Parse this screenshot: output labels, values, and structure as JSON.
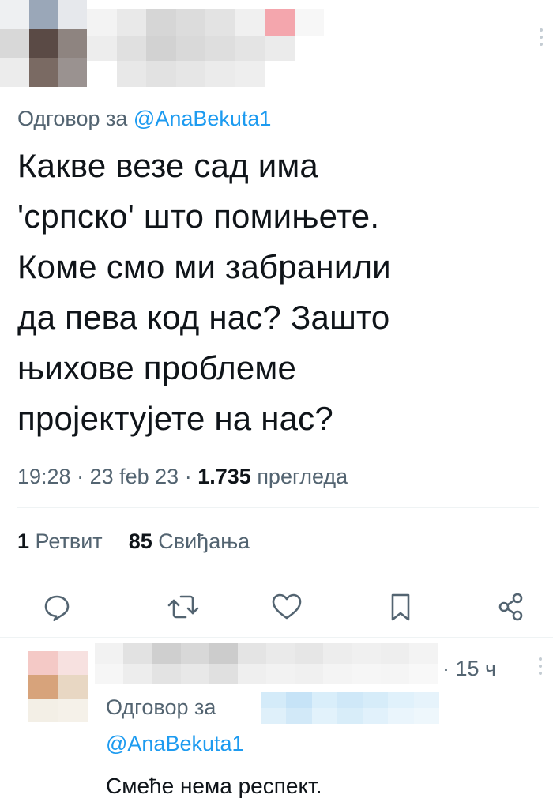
{
  "tweet": {
    "reply_prefix": "Одговор за",
    "reply_handle": "@AnaBekuta1",
    "text_lines": [
      "Какве везе сад има",
      "'српско' што помињете.",
      "Коме смо ми забранили",
      "да пева код нас? Зашто",
      "њихове проблеме",
      "пројектујете на нас?"
    ],
    "time": "19:28",
    "date": "23 feb 23",
    "views_count": "1.735",
    "views_label": "прегледа",
    "retweets_count": "1",
    "retweets_label": "Ретвит",
    "likes_count": "85",
    "likes_label": "Свиђања"
  },
  "reply": {
    "time_ago": "15 ч",
    "reply_prefix": "Одговор за",
    "reply_handle": "@AnaBekuta1",
    "text": "Смеће нема респект."
  },
  "actions": {
    "reply_icon": "reply-icon",
    "retweet_icon": "retweet-icon",
    "like_icon": "heart-icon",
    "bookmark_icon": "bookmark-icon",
    "share_icon": "share-icon"
  }
}
